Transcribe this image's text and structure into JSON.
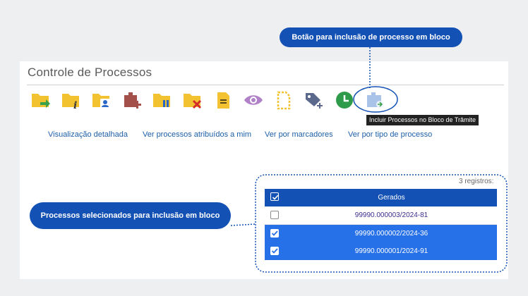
{
  "page": {
    "title": "Controle de Processos"
  },
  "callouts": {
    "top": "Botão para inclusão de processo em bloco",
    "left": "Processos selecionados para inclusão em bloco"
  },
  "toolbar": {
    "icons": [
      {
        "name": "send-folder-icon",
        "color": "#f2c230"
      },
      {
        "name": "folder-info-icon",
        "color": "#f2c230"
      },
      {
        "name": "folder-user-icon",
        "color": "#f2c230"
      },
      {
        "name": "add-block-icon",
        "color": "#a3504a"
      },
      {
        "name": "folder-pause-icon",
        "color": "#f2c230"
      },
      {
        "name": "folder-close-icon",
        "color": "#f2c230"
      },
      {
        "name": "document-note-icon",
        "color": "#f2c230"
      },
      {
        "name": "eye-icon",
        "color": "#b081c9"
      },
      {
        "name": "dashed-document-icon",
        "color": "#f2c230"
      },
      {
        "name": "tag-add-icon",
        "color": "#5b6a8c"
      },
      {
        "name": "clock-icon",
        "color": "#2e9b4b"
      },
      {
        "name": "include-block-icon",
        "color": "#a9c3e8"
      }
    ],
    "tooltip": "Incluir Processos no Bloco de Trâmite"
  },
  "views": {
    "detailed": "Visualização detalhada",
    "assigned": "Ver processos atribuídos a mim",
    "by_marker": "Ver por marcadores",
    "by_type": "Ver por tipo de processo"
  },
  "table": {
    "count": "3 registros:",
    "header": "Gerados",
    "rows": [
      {
        "process": "99990.000003/2024-81",
        "selected": false
      },
      {
        "process": "99990.000002/2024-36",
        "selected": true
      },
      {
        "process": "99990.000001/2024-91",
        "selected": true
      }
    ]
  },
  "colors": {
    "brand_blue": "#1351b4",
    "selected_row": "#2670e8",
    "link": "#1d5fa8"
  }
}
